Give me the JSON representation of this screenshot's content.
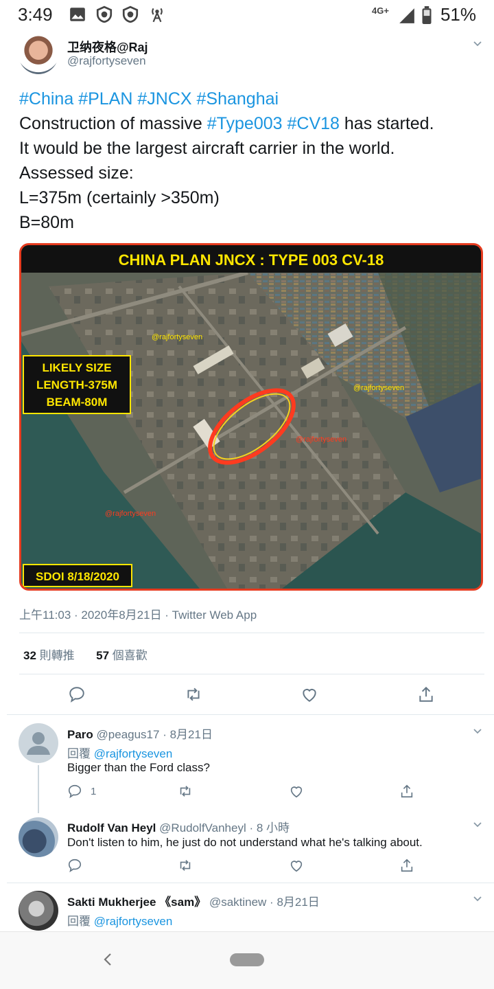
{
  "status_bar": {
    "time": "3:49",
    "network": "4G+",
    "battery": "51%"
  },
  "tweet": {
    "author_name": "卫纳夜格@Raj",
    "author_handle": "@rajfortyseven",
    "lines": [
      [
        {
          "t": "#China",
          "tag": true
        },
        {
          "t": " ",
          "tag": false
        },
        {
          "t": "#PLAN",
          "tag": true
        },
        {
          "t": " ",
          "tag": false
        },
        {
          "t": "#JNCX",
          "tag": true
        },
        {
          "t": " ",
          "tag": false
        },
        {
          "t": "#Shanghai",
          "tag": true
        }
      ],
      [
        {
          "t": "Construction of massive ",
          "tag": false
        },
        {
          "t": "#Type003",
          "tag": true
        },
        {
          "t": " ",
          "tag": false
        },
        {
          "t": "#CV18",
          "tag": true
        },
        {
          "t": " has started.",
          "tag": false
        }
      ],
      [
        {
          "t": "It would be the largest aircraft carrier in the world.",
          "tag": false
        }
      ],
      [
        {
          "t": "Assessed size:",
          "tag": false
        }
      ],
      [
        {
          "t": "L=375m (certainly >350m)",
          "tag": false
        }
      ],
      [
        {
          "t": "B=80m",
          "tag": false
        }
      ]
    ],
    "image": {
      "banner": "CHINA PLAN JNCX : TYPE 003 CV-18",
      "size_box": [
        "LIKELY SIZE",
        "LENGTH-375M",
        "BEAM-80M"
      ],
      "date_box": "SDOI 8/18/2020",
      "watermark": "@rajfortyseven"
    },
    "meta": "上午11:03 · 2020年8月21日 · Twitter Web App",
    "retweets_count": "32",
    "retweets_label": "則轉推",
    "likes_count": "57",
    "likes_label": "個喜歡"
  },
  "replies": [
    {
      "name": "Paro",
      "handle_time": "@peagus17 · 8月21日",
      "reply_prefix": "回覆",
      "reply_to": "@rajfortyseven",
      "text": "Bigger than the Ford class?",
      "reply_count": "1"
    },
    {
      "name": "Rudolf Van Heyl",
      "handle_time": "@RudolfVanheyl · 8 小時",
      "text": "Don't listen to him, he just do not understand what he's talking about."
    },
    {
      "name": "Sakti Mukherjee 《sam》",
      "handle_time": "@saktinew · 8月21日",
      "reply_prefix": "回覆",
      "reply_to": "@rajfortyseven"
    }
  ],
  "colors": {
    "link": "#1b95e0",
    "secondary": "#657786",
    "banner_text": "#ffe600",
    "ellipse": "#ff3b1f"
  }
}
